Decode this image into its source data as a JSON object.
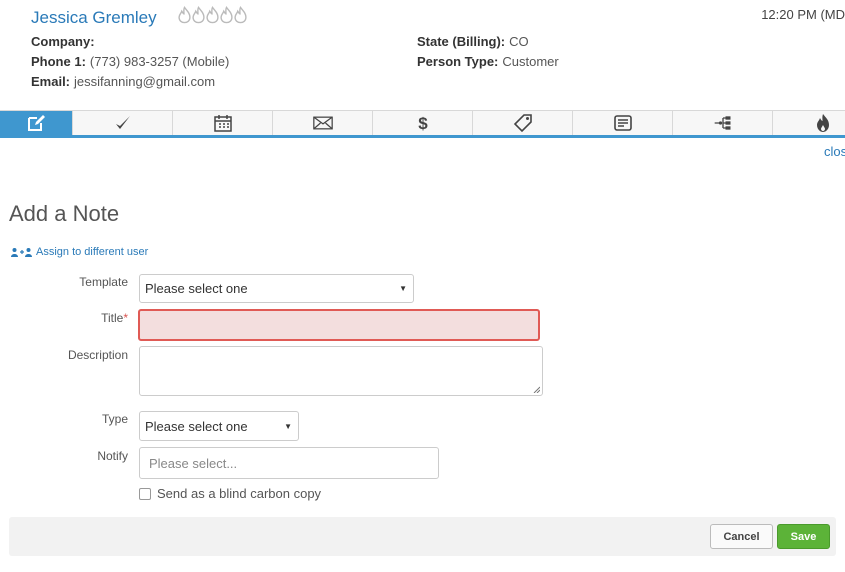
{
  "contact": {
    "name": "Jessica Gremley",
    "time": "12:20 PM (MD",
    "fields_left": [
      {
        "label": "Company:",
        "value": ""
      },
      {
        "label": "Phone 1:",
        "value": "(773) 983-3257 (Mobile)"
      },
      {
        "label": "Email:",
        "value": "jessifanning@gmail.com"
      }
    ],
    "fields_right": [
      {
        "label": "State (Billing):",
        "value": "CO"
      },
      {
        "label": "Person Type:",
        "value": "Customer"
      }
    ],
    "rating_icons": [
      "flame-icon",
      "flame-icon",
      "flame-icon",
      "flame-icon",
      "flame-icon"
    ]
  },
  "tabs": [
    {
      "icon": "edit-note-icon",
      "active": true
    },
    {
      "icon": "checkmark-icon"
    },
    {
      "icon": "calendar-icon"
    },
    {
      "icon": "envelope-icon"
    },
    {
      "icon": "dollar-icon"
    },
    {
      "icon": "tag-icon"
    },
    {
      "icon": "document-icon"
    },
    {
      "icon": "hierarchy-icon"
    },
    {
      "icon": "flame-icon"
    }
  ],
  "close_label": "clos",
  "form": {
    "title": "Add a Note",
    "assign_label": "Assign to different user",
    "template_label": "Template",
    "template_value": "Please select one",
    "title_label": "Title",
    "title_required_mark": "*",
    "description_label": "Description",
    "type_label": "Type",
    "type_value": "Please select one",
    "notify_label": "Notify",
    "notify_placeholder": "Please select...",
    "bcc_label": "Send as a blind carbon copy",
    "cancel_label": "Cancel",
    "save_label": "Save"
  },
  "colors": {
    "accent": "#3f97cf",
    "link": "#2a7ab8",
    "error_border": "#e05a55",
    "error_fill": "#f3dede",
    "save_green": "#5cb338"
  }
}
